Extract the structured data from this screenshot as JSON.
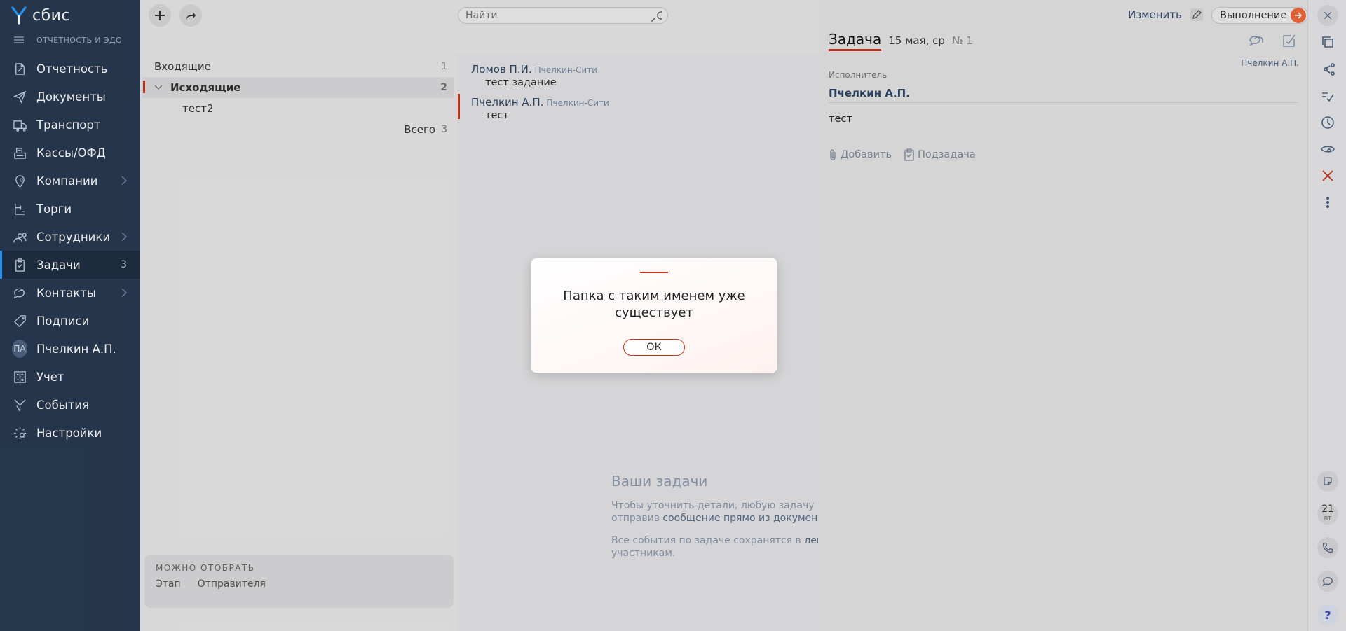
{
  "app": {
    "logo_text": "сбис",
    "section": "ОТЧЕТНОСТЬ И ЭДО"
  },
  "nav": [
    {
      "label": "Отчетность",
      "icon": "report-icon"
    },
    {
      "label": "Документы",
      "icon": "send-icon"
    },
    {
      "label": "Транспорт",
      "icon": "truck-icon"
    },
    {
      "label": "Кассы/ОФД",
      "icon": "cashbox-icon"
    },
    {
      "label": "Компании",
      "icon": "location-icon",
      "chevron": true
    },
    {
      "label": "Торги",
      "icon": "auction-icon"
    },
    {
      "label": "Сотрудники",
      "icon": "people-icon",
      "chevron": true
    },
    {
      "label": "Задачи",
      "icon": "clipboard-icon",
      "count": "3",
      "active": true
    },
    {
      "label": "Контакты",
      "icon": "chat-icon",
      "chevron": true
    },
    {
      "label": "Подписи",
      "icon": "tag-icon"
    },
    {
      "label": "Пчелкин А.П.",
      "icon": "avatar",
      "avatar_text": "ПА"
    },
    {
      "label": "Учет",
      "icon": "calculator-icon"
    },
    {
      "label": "События",
      "icon": "events-icon"
    },
    {
      "label": "Настройки",
      "icon": "gear-icon"
    }
  ],
  "search": {
    "placeholder": "Найти"
  },
  "folders": {
    "items": [
      {
        "label": "Входящие",
        "count": "1"
      },
      {
        "label": "Исходящие",
        "count": "2",
        "selected": true,
        "expanded": true
      },
      {
        "label": "тест2",
        "count": "",
        "child": true
      }
    ],
    "total_label": "Всего",
    "total_count": "3"
  },
  "filter": {
    "title": "МОЖНО ОТОБРАТЬ",
    "links": [
      "Этап",
      "Отправителя"
    ]
  },
  "tasks": [
    {
      "author": "Ломов П.И.",
      "org": "Пчелкин-Сити",
      "text": "тест задание"
    },
    {
      "author": "Пчелкин А.П.",
      "org": "Пчелкин-Сити",
      "text": "тест",
      "marked": true
    }
  ],
  "empty_state": {
    "title": "Ваши задачи",
    "line1": "Чтобы уточнить детали, любую задачу в СБ",
    "line2_pre": "отправив ",
    "line2_link": "сообщение прямо из документа",
    "line2_post": ".",
    "line3_pre": "Все события по задаче сохранятся в ",
    "line3_link": "ленте",
    "line4": "участникам."
  },
  "card": {
    "edit_label": "Изменить",
    "exec_button": "Выполнение",
    "title": "Задача",
    "date": "15 мая, ср",
    "number": "№ 1",
    "author": "Пчелкин А.П.",
    "executor_label": "Исполнитель",
    "executor": "Пчелкин А.П.",
    "body": "тест",
    "add_label": "Добавить",
    "subtask_label": "Подзадача"
  },
  "rail": {
    "calendar_day": "21",
    "calendar_weekday": "ВТ",
    "help": "?"
  },
  "dialog": {
    "message": "Папка с таким именем уже существует",
    "ok_label": "ОК"
  },
  "colors": {
    "sidebar": "#283b52",
    "accent": "#c9341b",
    "exec_button": "#f1683b",
    "active_marker": "#2d9cff"
  }
}
